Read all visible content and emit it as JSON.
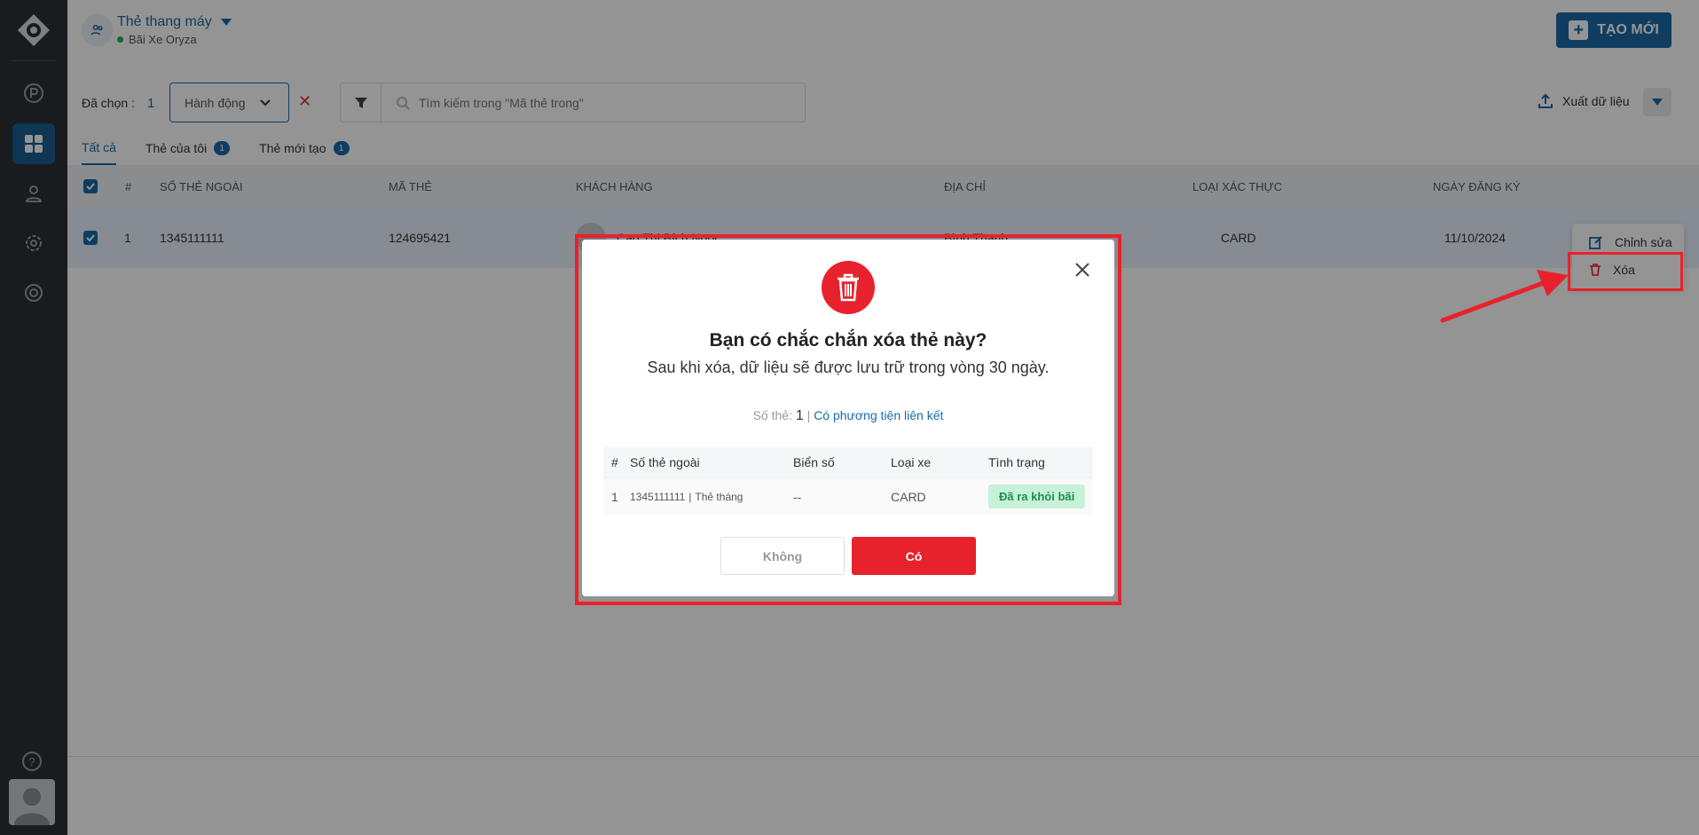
{
  "header": {
    "title": "Thẻ thang máy",
    "subtitle": "Bãi Xe Oryza",
    "new_button": "TẠO MỚI"
  },
  "toolbar": {
    "selected_label": "Đã chọn :",
    "selected_count": "1",
    "action_dropdown": "Hành động",
    "search_placeholder": "Tìm kiếm trong \"Mã thẻ trong\"",
    "export_label": "Xuất dữ liệu"
  },
  "tabs": [
    {
      "label": "Tất cả",
      "badge": ""
    },
    {
      "label": "Thẻ của tôi",
      "badge": "1"
    },
    {
      "label": "Thẻ mới tạo",
      "badge": "1"
    }
  ],
  "table": {
    "headers": {
      "index": "#",
      "outer_card": "SỐ THẺ NGOÀI",
      "card_code": "MÃ THẺ",
      "customer": "KHÁCH HÀNG",
      "address": "ĐỊA CHỈ",
      "auth_type": "LOẠI XÁC THỰC",
      "reg_date": "NGÀY ĐĂNG KÝ"
    },
    "rows": [
      {
        "index": "1",
        "outer_card": "1345111111",
        "card_code": "124695421",
        "customer": "Cao Thị Bích Ngọc",
        "address": "Bình Thạnh",
        "auth_type": "CARD",
        "reg_date": "11/10/2024"
      }
    ]
  },
  "context_menu": {
    "edit": "Chỉnh sửa",
    "delete": "Xóa"
  },
  "modal": {
    "title": "Bạn có chắc chắn xóa thẻ này?",
    "subtitle": "Sau khi xóa, dữ liệu sẽ được lưu trữ trong vòng 30 ngày.",
    "count_label": "Số thẻ:",
    "count_value": "1",
    "count_sep": "|",
    "linked_text": "Có phương tiện liên kết",
    "table_headers": {
      "index": "#",
      "outer_card": "Số thẻ ngoài",
      "plate": "Biển số",
      "vehicle": "Loại xe",
      "status": "Tình trạng"
    },
    "table_row": {
      "index": "1",
      "outer_card": "1345111111",
      "card_type": "Thẻ tháng",
      "plate": "--",
      "vehicle": "CARD",
      "status": "Đã ra khỏi bãi"
    },
    "no_button": "Không",
    "yes_button": "Có"
  },
  "colors": {
    "primary": "#1a6aa8",
    "danger": "#e8222c",
    "sidebar": "#2b2f36"
  }
}
